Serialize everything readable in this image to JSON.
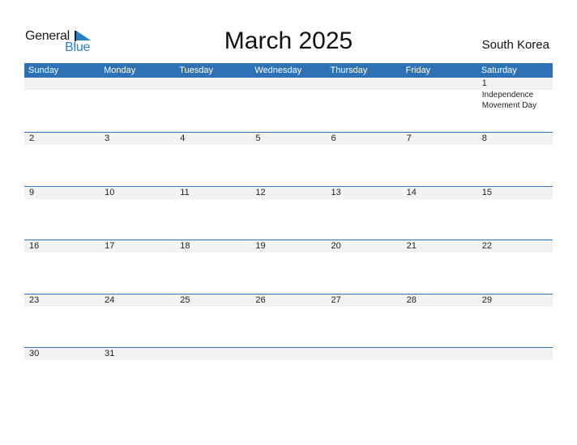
{
  "logo": {
    "general": "General",
    "blue": "Blue"
  },
  "title": "March 2025",
  "country": "South Korea",
  "colors": {
    "accent": "#2e72b5",
    "daybar": "#f2f2f2",
    "logo_blue": "#2a7fc9"
  },
  "weekdays": [
    "Sunday",
    "Monday",
    "Tuesday",
    "Wednesday",
    "Thursday",
    "Friday",
    "Saturday"
  ],
  "weeks": [
    [
      "",
      "",
      "",
      "",
      "",
      "",
      "1"
    ],
    [
      "2",
      "3",
      "4",
      "5",
      "6",
      "7",
      "8"
    ],
    [
      "9",
      "10",
      "11",
      "12",
      "13",
      "14",
      "15"
    ],
    [
      "16",
      "17",
      "18",
      "19",
      "20",
      "21",
      "22"
    ],
    [
      "23",
      "24",
      "25",
      "26",
      "27",
      "28",
      "29"
    ],
    [
      "30",
      "31",
      "",
      "",
      "",
      "",
      ""
    ]
  ],
  "holidays": [
    {
      "week": 0,
      "day": 6,
      "lines": [
        "Independence",
        "Movement Day"
      ]
    }
  ]
}
